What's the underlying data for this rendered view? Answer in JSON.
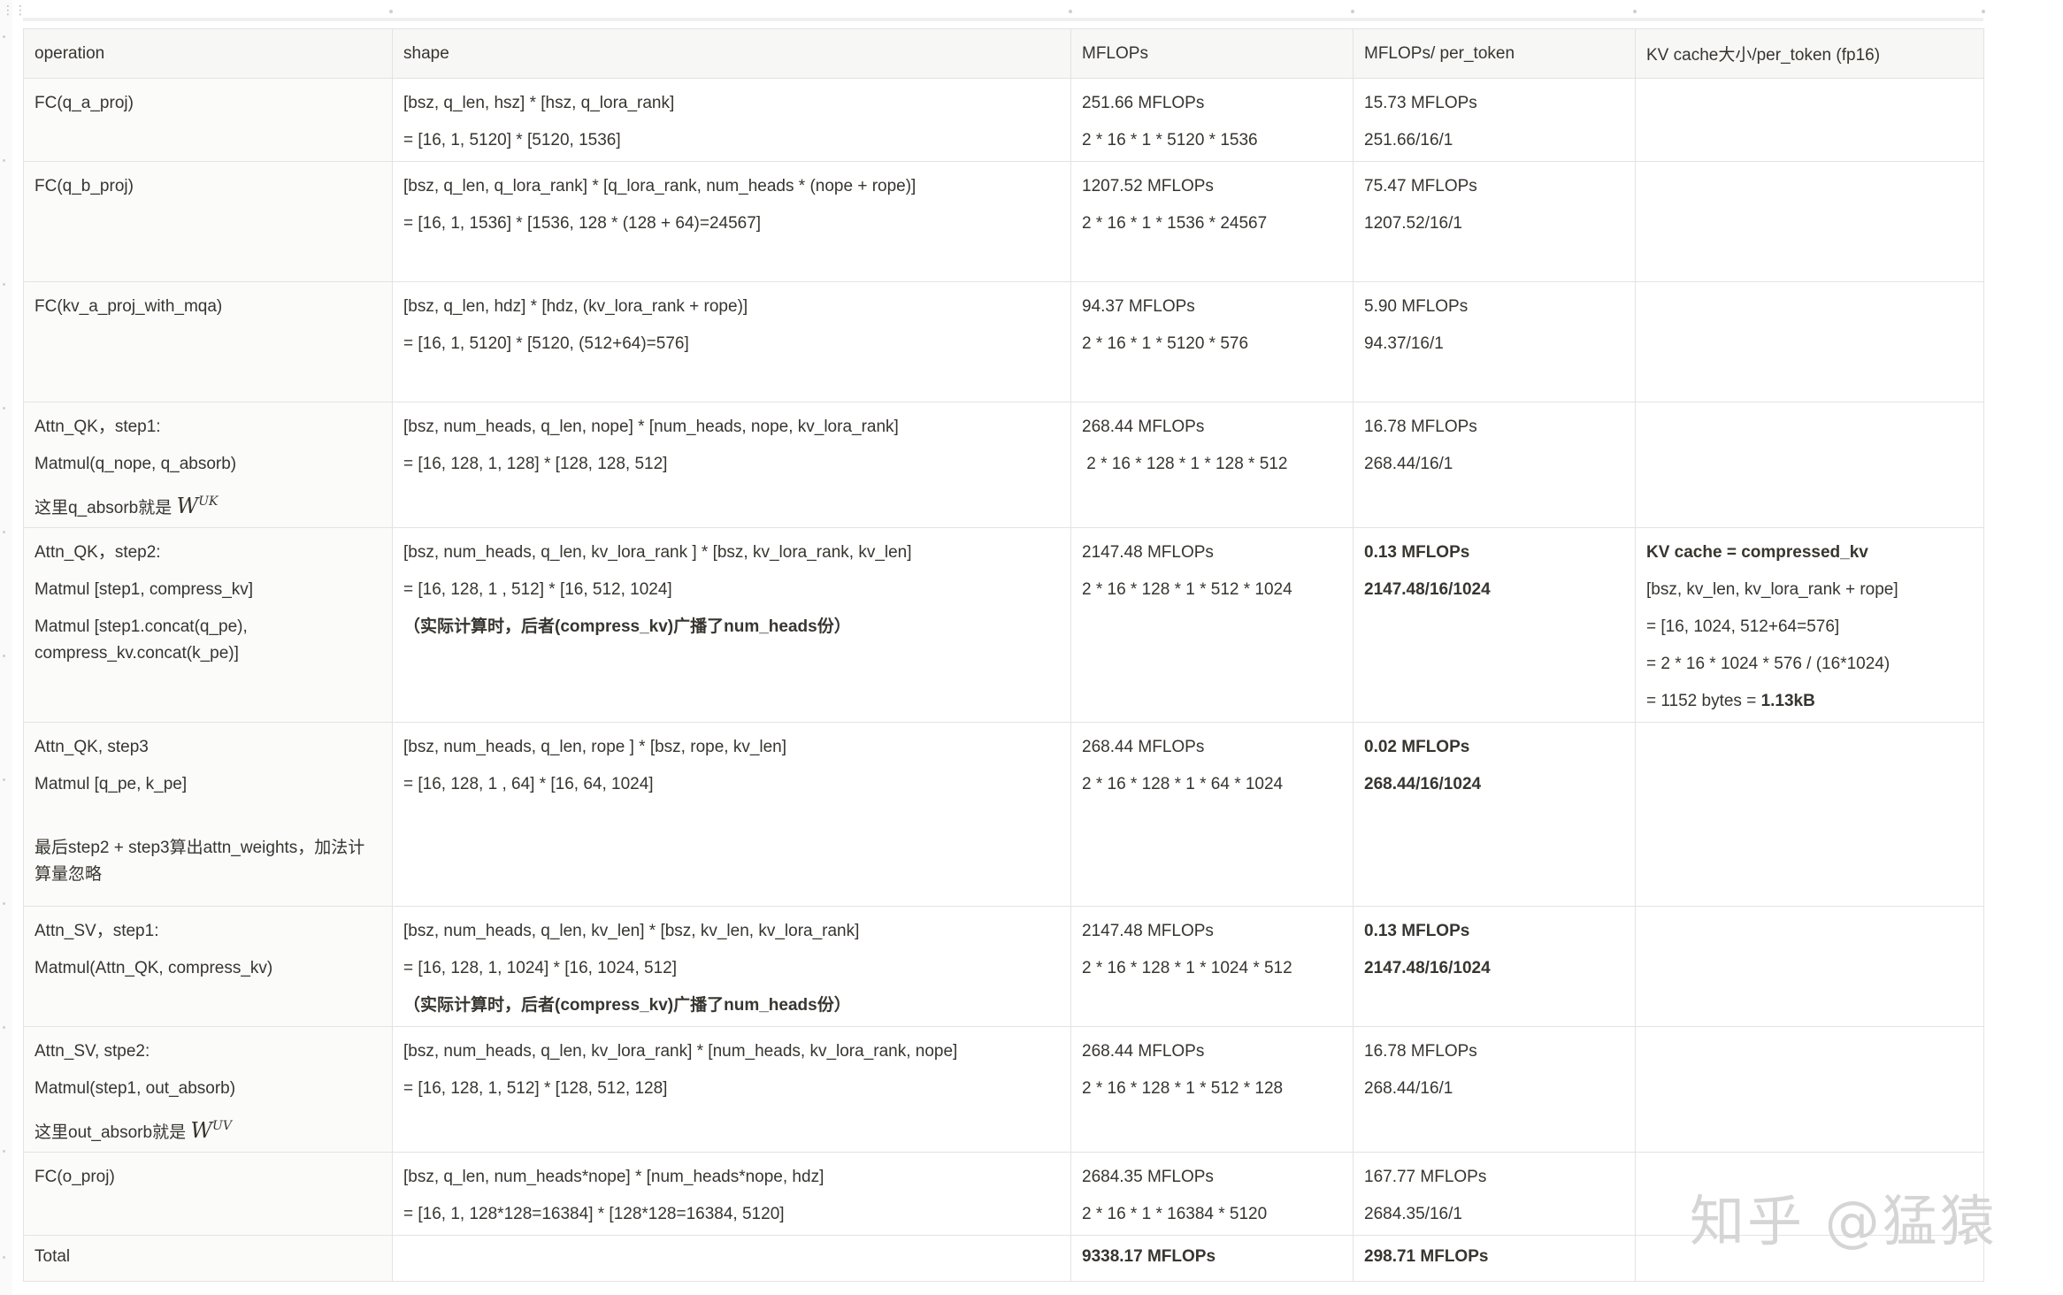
{
  "table": {
    "headers": [
      "operation",
      "shape",
      "MFLOPs",
      "MFLOPs/ per_token",
      "KV cache大小/per_token (fp16)"
    ],
    "rows": [
      {
        "operation": [
          "FC(q_a_proj)"
        ],
        "shape": [
          "[bsz, q_len, hsz] * [hsz, q_lora_rank]",
          "= [16, 1, 5120] * [5120, 1536]"
        ],
        "mflops": [
          "251.66 MFLOPs",
          "2 * 16 * 1 * 5120 * 1536"
        ],
        "per_token": [
          "15.73 MFLOPs",
          "251.66/16/1"
        ],
        "kv_cache": []
      },
      {
        "operation": [
          "FC(q_b_proj)"
        ],
        "shape": [
          "[bsz, q_len, q_lora_rank] * [q_lora_rank, num_heads * (nope + rope)]",
          "= [16, 1, 1536] * [1536, 128 * (128 + 64)=24567]"
        ],
        "mflops": [
          "1207.52 MFLOPs",
          "2 * 16 * 1 * 1536 * 24567"
        ],
        "per_token": [
          "75.47 MFLOPs",
          "1207.52/16/1"
        ],
        "kv_cache": []
      },
      {
        "operation": [
          "FC(kv_a_proj_with_mqa)"
        ],
        "shape": [
          "[bsz, q_len, hdz] * [hdz, (kv_lora_rank + rope)]",
          "= [16, 1, 5120] * [5120, (512+64)=576]"
        ],
        "mflops": [
          "94.37 MFLOPs",
          "2 * 16 * 1 * 5120 * 576"
        ],
        "per_token": [
          "5.90 MFLOPs",
          "94.37/16/1"
        ],
        "kv_cache": []
      },
      {
        "operation": [
          "Attn_QK，step1:",
          "Matmul(q_nope, q_absorb)",
          "这里q_absorb就是"
        ],
        "operation_math": {
          "base": "W",
          "sup": "UK"
        },
        "shape": [
          "[bsz, num_heads, q_len, nope] * [num_heads, nope, kv_lora_rank]",
          "= [16, 128, 1, 128] * [128, 128, 512]"
        ],
        "mflops": [
          "268.44 MFLOPs",
          " 2 * 16 * 128 * 1 * 128 * 512"
        ],
        "per_token": [
          "16.78 MFLOPs",
          "268.44/16/1"
        ],
        "kv_cache": []
      },
      {
        "operation": [
          "Attn_QK，step2:",
          "Matmul [step1, compress_kv]",
          "Matmul [step1.concat(q_pe), compress_kv.concat(k_pe)]"
        ],
        "shape": [
          "[bsz, num_heads, q_len, kv_lora_rank ] * [bsz, kv_lora_rank, kv_len]",
          "= [16, 128, 1 , 512] * [16, 512, 1024]",
          "（实际计算时，后者(compress_kv)广播了num_heads份）"
        ],
        "mflops": [
          "2147.48 MFLOPs",
          "2 * 16 * 128 * 1 * 512 * 1024"
        ],
        "per_token": [
          "0.13 MFLOPs",
          "2147.48/16/1024"
        ],
        "kv_cache": [
          "KV cache = compressed_kv",
          "[bsz, kv_len, kv_lora_rank + rope]",
          "= [16, 1024, 512+64=576]",
          "= 2 * 16 * 1024 * 576 / (16*1024)",
          "= 1152 bytes = ",
          "1.13kB"
        ]
      },
      {
        "operation": [
          "Attn_QK, step3",
          "Matmul [q_pe, k_pe]",
          "最后step2 + step3算出attn_weights，加法计算量忽略"
        ],
        "shape": [
          "[bsz, num_heads, q_len, rope ] * [bsz, rope, kv_len]",
          "= [16, 128, 1 , 64] * [16, 64, 1024]"
        ],
        "mflops": [
          "268.44 MFLOPs",
          "2 * 16 * 128 * 1 * 64 * 1024"
        ],
        "per_token": [
          "0.02 MFLOPs",
          "268.44/16/1024"
        ],
        "kv_cache": []
      },
      {
        "operation": [
          "Attn_SV，step1:",
          "Matmul(Attn_QK, compress_kv)"
        ],
        "shape": [
          "[bsz, num_heads, q_len, kv_len] * [bsz, kv_len, kv_lora_rank]",
          "= [16, 128, 1, 1024] * [16, 1024, 512]",
          "（实际计算时，后者(compress_kv)广播了num_heads份）"
        ],
        "mflops": [
          "2147.48 MFLOPs",
          "2 * 16 * 128 * 1 * 1024 * 512"
        ],
        "per_token": [
          "0.13 MFLOPs",
          "2147.48/16/1024"
        ],
        "kv_cache": []
      },
      {
        "operation": [
          "Attn_SV, stpe2:",
          "Matmul(step1, out_absorb)",
          "这里out_absorb就是"
        ],
        "operation_math": {
          "base": "W",
          "sup": "UV"
        },
        "shape": [
          "[bsz, num_heads, q_len, kv_lora_rank] * [num_heads, kv_lora_rank, nope]",
          "= [16, 128, 1, 512] * [128, 512, 128]"
        ],
        "mflops": [
          "268.44 MFLOPs",
          "2 * 16 * 128 * 1 * 512 * 128"
        ],
        "per_token": [
          "16.78 MFLOPs",
          "268.44/16/1"
        ],
        "kv_cache": []
      },
      {
        "operation": [
          "FC(o_proj)"
        ],
        "shape": [
          "[bsz, q_len, num_heads*nope] * [num_heads*nope, hdz]",
          "= [16, 1, 128*128=16384] * [128*128=16384, 5120]"
        ],
        "mflops": [
          "2684.35 MFLOPs",
          "2 * 16 * 1 * 16384 * 5120"
        ],
        "per_token": [
          "167.77 MFLOPs",
          "2684.35/16/1"
        ],
        "kv_cache": []
      }
    ],
    "total": {
      "label": "Total",
      "shape": "",
      "mflops": "9338.17 MFLOPs",
      "per_token": "298.71 MFLOPs",
      "kv_cache": ""
    }
  },
  "watermark": "知乎 @猛猿",
  "icons": {
    "drag_handle": "drag-handle-icon"
  }
}
